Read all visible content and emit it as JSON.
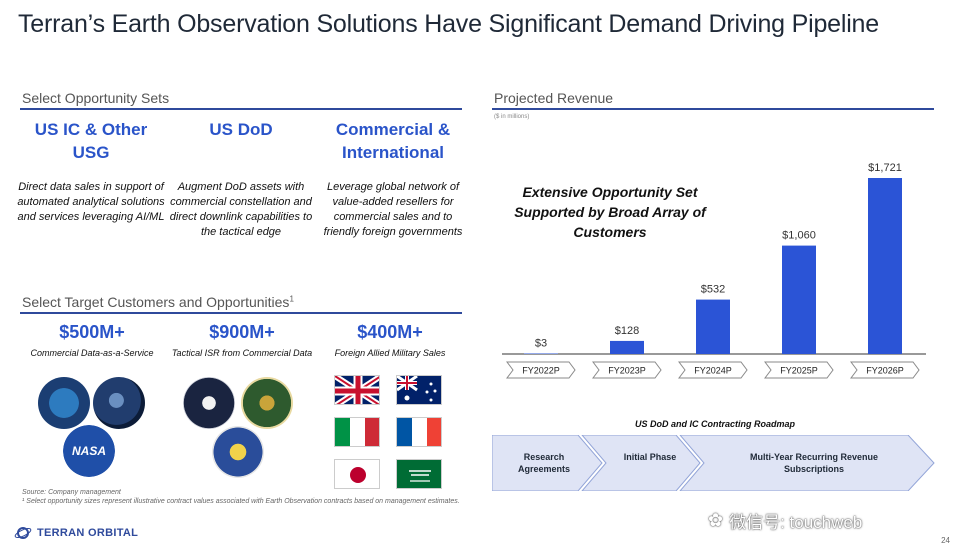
{
  "page": {
    "title": "Terran’s Earth Observation Solutions Have Significant Demand Driving Pipeline",
    "page_number": "24"
  },
  "opportunity": {
    "heading": "Select Opportunity Sets",
    "items": [
      {
        "title": "US IC & Other USG",
        "desc": "Direct data sales in support of automated analytical solutions and services leveraging AI/ML"
      },
      {
        "title": "US DoD",
        "desc": "Augment DoD assets with commercial constellation and direct downlink capabilities to the tactical edge"
      },
      {
        "title": "Commercial & International",
        "desc": "Leverage global network of value-added resellers for commercial sales and to friendly foreign governments"
      }
    ]
  },
  "targets": {
    "heading": "Select Target Customers and Opportunities",
    "heading_sup": "1",
    "items": [
      {
        "amount": "$500M+",
        "desc": "Commercial Data-as-a-Service"
      },
      {
        "amount": "$900M+",
        "desc": "Tactical ISR from Commercial Data"
      },
      {
        "amount": "$400M+",
        "desc": "Foreign Allied Military Sales"
      }
    ],
    "nasa_label": "NASA"
  },
  "footnotes": {
    "source": "Source: Company management",
    "note": "¹ Select opportunity sizes represent illustrative contract values associated with Earth Observation contracts based on management estimates."
  },
  "logo": {
    "text": "TERRAN ORBITAL"
  },
  "revenue": {
    "heading": "Projected Revenue",
    "units": "($ in millions)",
    "callout": "Extensive Opportunity Set Supported by Broad Array of Customers"
  },
  "chart_data": {
    "type": "bar",
    "categories": [
      "FY2022P",
      "FY2023P",
      "FY2024P",
      "FY2025P",
      "FY2026P"
    ],
    "values": [
      3,
      128,
      532,
      1060,
      1721
    ],
    "data_labels": [
      "$3",
      "$128",
      "$532",
      "$1,060",
      "$1,721"
    ],
    "title": "",
    "xlabel": "",
    "ylabel": "",
    "ylim": [
      0,
      1721
    ],
    "grid": false,
    "bar_color": "#2b54d6"
  },
  "roadmap": {
    "title": "US DoD and IC Contracting Roadmap",
    "stages": [
      "Research Agreements",
      "Initial Phase",
      "Multi-Year Recurring Revenue Subscriptions"
    ]
  },
  "watermark": {
    "text": "微信号: touchweb"
  },
  "colors": {
    "accent": "#2a54c9",
    "rule": "#2f4a9c",
    "bar": "#2b54d6",
    "roadmap_fill": "#dfe4f5"
  }
}
